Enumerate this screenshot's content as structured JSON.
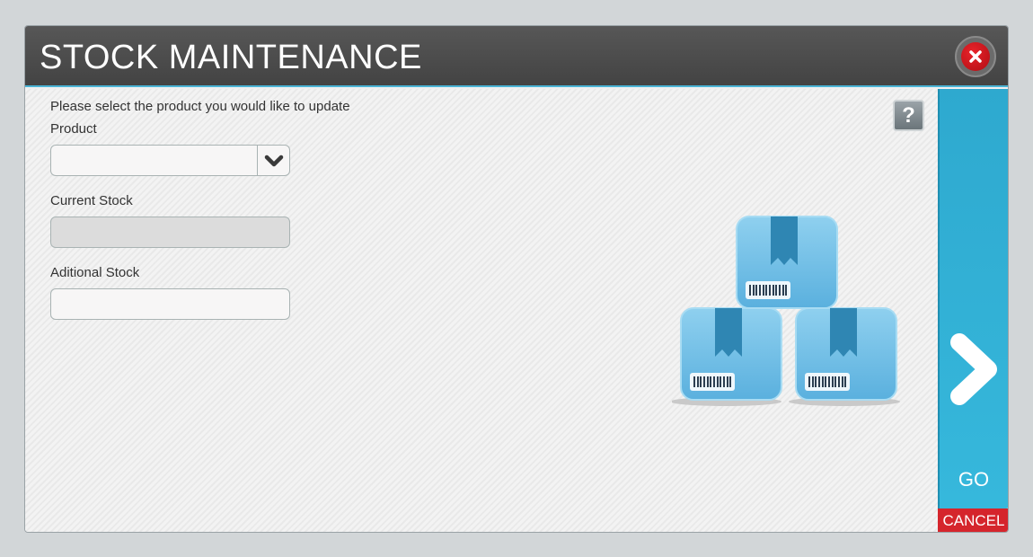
{
  "dialog": {
    "title": "STOCK MAINTENANCE",
    "close_icon": "close-icon"
  },
  "form": {
    "instruction": "Please select the product you would like to update",
    "product_label": "Product",
    "product_value": "",
    "current_stock_label": "Current Stock",
    "current_stock_value": "",
    "additional_stock_label": "Aditional Stock",
    "additional_stock_value": ""
  },
  "help": {
    "label": "?"
  },
  "illustration": {
    "icon": "boxes-icon"
  },
  "actions": {
    "go_label": "GO",
    "cancel_label": "CANCEL"
  },
  "colors": {
    "accent": "#36b8dc",
    "titlebar": "#4a4a4a",
    "cancel": "#d5252c",
    "close": "#cf1a20"
  }
}
